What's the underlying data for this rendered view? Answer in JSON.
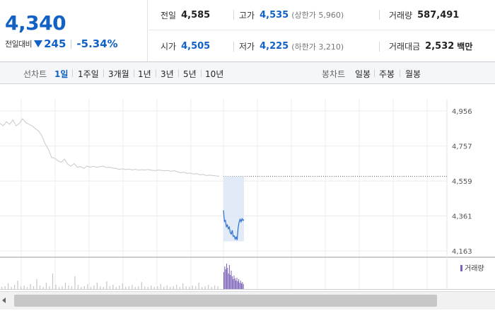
{
  "summary": {
    "current_price": "4,340",
    "change_label": "전일대비",
    "change_direction_icon": "down-triangle-icon",
    "change_value": "245",
    "change_rate": "-5.34%",
    "row1": [
      {
        "label": "전일",
        "value": "4,585",
        "sub": ""
      },
      {
        "label": "고가",
        "value": "4,535",
        "sub": "(상한가 5,960)"
      },
      {
        "label": "거래량",
        "value": "587,491",
        "sub": ""
      }
    ],
    "row2": [
      {
        "label": "시가",
        "value": "4,505",
        "sub": ""
      },
      {
        "label": "저가",
        "value": "4,225",
        "sub": "(하한가 3,210)"
      },
      {
        "label": "거래대금",
        "value": "2,532",
        "sub": "백만"
      }
    ]
  },
  "toolbar": {
    "line_chart_label": "선차트",
    "line_periods": [
      "1일",
      "1주일",
      "3개월",
      "1년",
      "3년",
      "5년",
      "10년"
    ],
    "active_period": "1일",
    "candle_chart_label": "봉차트",
    "candle_periods": [
      "일봉",
      "주봉",
      "월봉"
    ]
  },
  "colors": {
    "price_down": "#1261c4",
    "prev_line": "#c9c9c9",
    "today_line": "#2a6dcf",
    "today_fill": "#dce7f7",
    "volume_prev": "#c6c6c6",
    "volume_today": "#7b62b8"
  },
  "chart_data": {
    "type": "line",
    "y_ticks": [
      "4,956",
      "4,757",
      "4,559",
      "4,361",
      "4,163"
    ],
    "y_tick_values": [
      4956,
      4757,
      4559,
      4361,
      4163
    ],
    "ylim": [
      4163,
      4956
    ],
    "reference_line_value": 4585,
    "previous_day_series": [
      4886,
      4872,
      4895,
      4880,
      4905,
      4872,
      4885,
      4912,
      4890,
      4880,
      4871,
      4855,
      4842,
      4815,
      4770,
      4740,
      4692,
      4688,
      4673,
      4665,
      4683,
      4655,
      4642,
      4658,
      4637,
      4641,
      4630,
      4644,
      4637,
      4642,
      4637,
      4640,
      4643,
      4635,
      4637,
      4632,
      4630,
      4625,
      4628,
      4624,
      4627,
      4622,
      4625,
      4620,
      4623,
      4621,
      4624,
      4620,
      4618,
      4621,
      4619,
      4617,
      4618,
      4614,
      4617,
      4612,
      4606,
      4609,
      4602,
      4604,
      4598,
      4601,
      4594,
      4596,
      4590,
      4592,
      4590,
      4588,
      4586
    ],
    "today_series": [
      4393,
      4330,
      4336,
      4300,
      4310,
      4288,
      4298,
      4265,
      4258,
      4280,
      4245,
      4248,
      4230,
      4242,
      4225,
      4292,
      4325,
      4342,
      4328,
      4345,
      4335,
      4340
    ],
    "volume_legend": "거래량",
    "volume_previous": [
      3,
      4,
      8,
      3,
      6,
      12,
      4,
      5,
      3,
      7,
      4,
      14,
      5,
      3,
      9,
      4,
      22,
      6,
      3,
      4,
      9,
      5,
      4,
      18,
      6,
      3,
      4,
      7,
      3,
      5,
      9,
      4,
      3,
      11,
      4,
      6,
      3,
      5,
      8,
      3,
      4,
      6,
      3,
      4,
      10,
      4,
      3,
      5,
      3,
      4,
      7,
      3,
      5,
      3,
      4,
      6,
      3,
      8,
      4,
      3,
      5,
      4,
      9,
      3,
      4,
      6,
      3,
      5,
      4
    ],
    "volume_today": [
      24,
      32,
      28,
      36,
      30,
      22,
      34,
      20,
      26,
      18,
      14,
      19,
      15,
      12,
      16,
      11,
      14,
      9,
      12,
      8,
      10,
      7
    ]
  }
}
